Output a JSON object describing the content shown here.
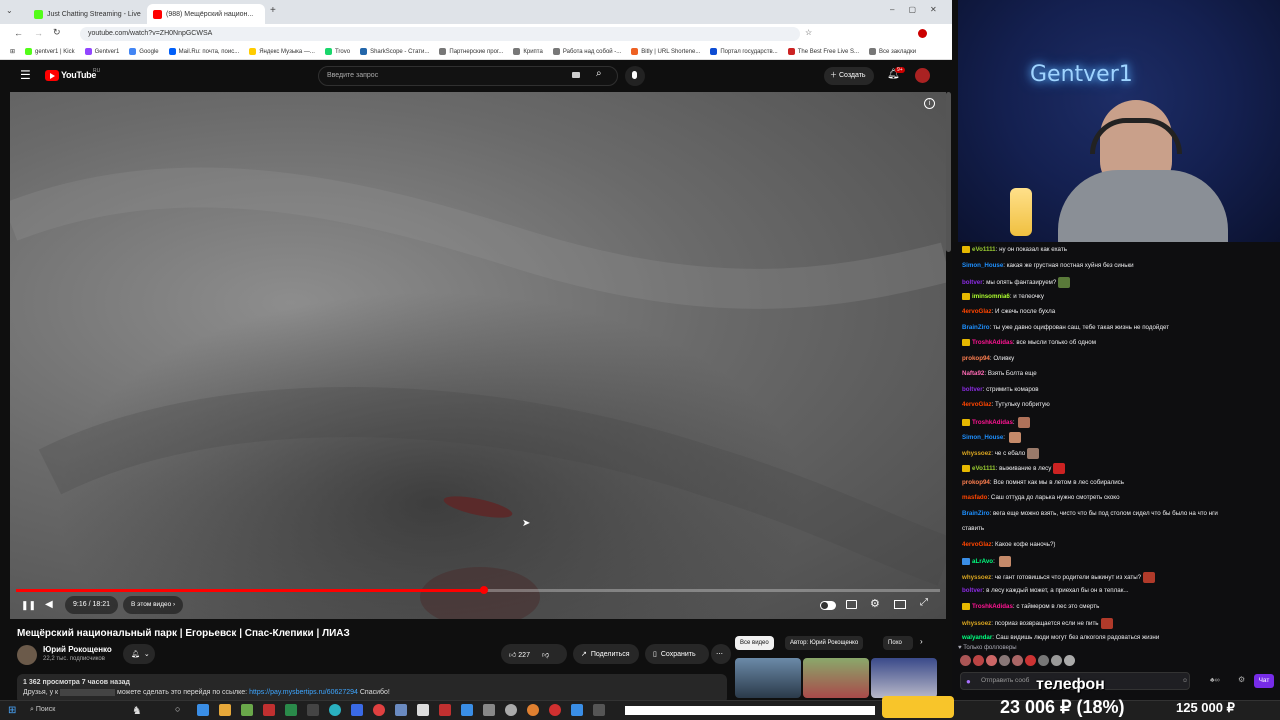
{
  "tabs": [
    {
      "label": "Just Chatting Streaming - Live",
      "color": "#53fc18"
    },
    {
      "label": "(988) Мещёрский национ...",
      "color": "#ff0000"
    }
  ],
  "address": "youtube.com/watch?v=ZH0NnpGCWSA",
  "bookmarks": [
    {
      "label": "gentver1 | Kick",
      "color": "#53fc18"
    },
    {
      "label": "Gentver1",
      "color": "#9146ff"
    },
    {
      "label": "Google",
      "color": "#4285f4"
    },
    {
      "label": "Mail.Ru: почта, поис...",
      "color": "#005ff9"
    },
    {
      "label": "Яндекс Музыка —...",
      "color": "#ffcc00"
    },
    {
      "label": "Trovo",
      "color": "#19d66b"
    },
    {
      "label": "SharkScope - Стати...",
      "color": "#2266aa"
    },
    {
      "label": "Партнерские прог...",
      "color": "#777777"
    },
    {
      "label": "Крипта",
      "color": "#777777"
    },
    {
      "label": "Работа над собой -...",
      "color": "#777777"
    },
    {
      "label": "Bitly | URL Shortene...",
      "color": "#ee6123"
    },
    {
      "label": "Портал государств...",
      "color": "#0d4cd3"
    },
    {
      "label": "The Best Free Live S...",
      "color": "#cc2222"
    },
    {
      "label": "Все закладки",
      "color": "#777777"
    }
  ],
  "youtube": {
    "logo_text": "YouTube",
    "logo_region": "RU",
    "search_placeholder": "Введите запрос",
    "create_label": "Создать",
    "notif_count": "9+"
  },
  "player": {
    "time": "9:16 / 18:21",
    "chapter": "В этом видео",
    "progress": 0.507
  },
  "video": {
    "title": "Мещёрский национальный парк | Егорьевск | Спас-Клепики | ЛИАЗ",
    "channel_name": "Юрий Рокощенко",
    "subscribers": "22,2 тыс. подписчиков",
    "likes": "227",
    "share_label": "Поделиться",
    "save_label": "Сохранить",
    "views_line": "1 362 просмотра  7 часов назад",
    "desc_prefix": "Друзья, у к",
    "desc_middle": "можете сделать это перейдя по ссылке:",
    "desc_link": "https://pay.mysbertips.ru/60627294",
    "desc_suffix": "Спасибо!"
  },
  "chips": [
    "Все видео",
    "Автор: Юрий Рокощенко",
    "Похо"
  ],
  "webcam": {
    "sign": "Gentver1"
  },
  "chat": [
    {
      "user": "eVo1111",
      "color": "#9acd32",
      "text": "ну он показал как ехать",
      "badge": "#e6b800"
    },
    {
      "user": "Simon_House",
      "color": "#1e90ff",
      "text": "какая же грустная постная хуйня без синьки",
      "badge": ""
    },
    {
      "user": "boltver",
      "color": "#8a2be2",
      "text": "мы опять фантазируем?",
      "badge": "",
      "emote": "#5a7a3a"
    },
    {
      "user": "iminsomnia6",
      "color": "#adff2f",
      "text": "и телеочку",
      "badge": "#e6b800"
    },
    {
      "user": "4ervoGlaz",
      "color": "#ff4500",
      "text": "И сжечь после буxла",
      "badge": ""
    },
    {
      "user": "BrainZiro",
      "color": "#1e90ff",
      "text": "ты уже давно оцифрован саш, тебе такая жизнь не подойдет",
      "badge": ""
    },
    {
      "user": "TroshkAdidas",
      "color": "#ff1493",
      "text": "все мысли только об одном",
      "badge": "#e6b800"
    },
    {
      "user": "prokop94",
      "color": "#ff7f50",
      "text": "Оливку",
      "badge": ""
    },
    {
      "user": "Nafta92",
      "color": "#ff69b4",
      "text": "Взять Болта еще",
      "badge": ""
    },
    {
      "user": "boltver",
      "color": "#8a2be2",
      "text": "стримить комаров",
      "badge": ""
    },
    {
      "user": "4ervoGlaz",
      "color": "#ff4500",
      "text": "Тутульку побритую",
      "badge": ""
    },
    {
      "user": "TroshkAdidas",
      "color": "#ff1493",
      "text": "",
      "badge": "#e6b800",
      "emote": "#b0725a"
    },
    {
      "user": "Simon_House",
      "color": "#1e90ff",
      "text": "",
      "badge": "",
      "emote": "#c58a6a"
    },
    {
      "user": "whyssoez",
      "color": "#daa520",
      "text": "че с ебало",
      "badge": "",
      "emote": "#9a7a6a"
    },
    {
      "user": "eVo1111",
      "color": "#9acd32",
      "text": "выживание в лесу",
      "badge": "#e6b800",
      "emote": "#cc2222"
    },
    {
      "user": "prokop94",
      "color": "#ff7f50",
      "text": "Все помнят как мы в летом в лес собирались",
      "badge": ""
    },
    {
      "user": "masfado",
      "color": "#ff4500",
      "text": "Саш оттуда до ларька нужно смотреть скоко",
      "badge": ""
    },
    {
      "user": "BrainZiro",
      "color": "#1e90ff",
      "text": "вега еще можно взять, чисто что бы под столом сидел что бы было на что нги",
      "badge": ""
    },
    {
      "user": "",
      "color": "#efeff1",
      "text": "ставить",
      "badge": ""
    },
    {
      "user": "4ervoGlaz",
      "color": "#ff4500",
      "text": "Какое кофе наночь?)",
      "badge": ""
    },
    {
      "user": "aLrAvo",
      "color": "#00ff7f",
      "text": "",
      "badge": "#3a8ee6",
      "emote": "#c58a6a"
    },
    {
      "user": "whyssoez",
      "color": "#daa520",
      "text": "че гант готовишься что родители выкинут из хаты?",
      "badge": "",
      "emote": "#b03a2a"
    },
    {
      "user": "boltver",
      "color": "#8a2be2",
      "text": "в лесу каждый может, а приехал бы он в теплак...",
      "badge": ""
    },
    {
      "user": "TroshkAdidas",
      "color": "#ff1493",
      "text": "с таймером в лес это смерть",
      "badge": "#e6b800"
    },
    {
      "user": "whyssoez",
      "color": "#daa520",
      "text": "псориаз возвращается если не пить",
      "badge": "",
      "emote": "#b03a2a"
    },
    {
      "user": "walyandar",
      "color": "#00ff7f",
      "text": "Саш видишь люди могут без алкоголя радоваться жизни",
      "badge": ""
    }
  ],
  "chat_followers": "Только фолловеры",
  "chat_input_placeholder": "Отправить сооб",
  "chat_send": "Чат",
  "overlay": {
    "phone_label": "телефон",
    "goal": "23 006 ₽ (18%)",
    "goal_total": "125 000 ₽"
  },
  "taskbar": {
    "search_label": "Поиск"
  }
}
